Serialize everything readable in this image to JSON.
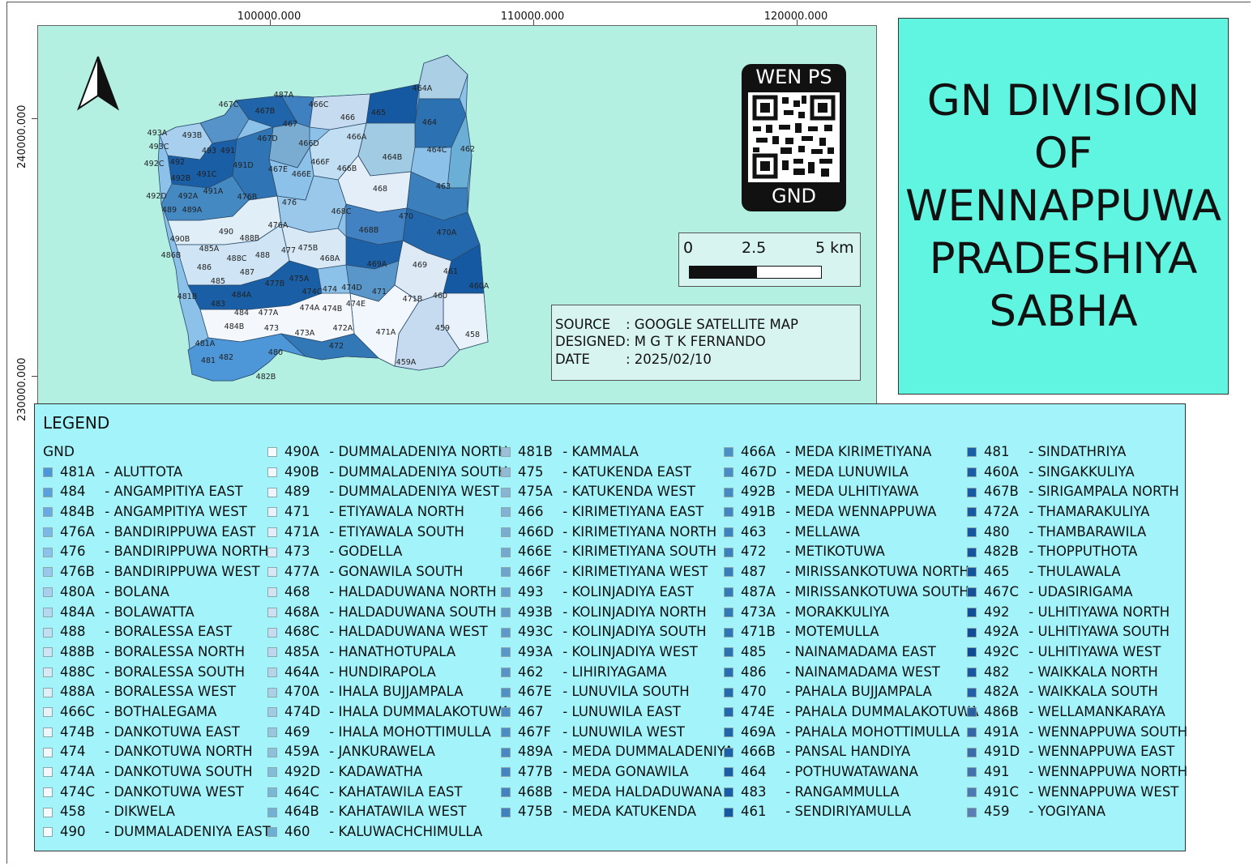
{
  "title": {
    "lines": [
      "GN  DIVISION",
      "OF",
      "WENNAPPUWA",
      "PRADESHIYA",
      "SABHA"
    ]
  },
  "map": {
    "x_coords": [
      "100000.000",
      "110000.000",
      "120000.000"
    ],
    "y_coords": [
      "240000.000",
      "230000.000"
    ],
    "background_color": "#b3f0e2",
    "north_arrow": "north-arrow-icon",
    "labels": [
      "464A",
      "466C",
      "487A",
      "467C",
      "467B",
      "467",
      "466",
      "465",
      "464",
      "493A",
      "493B",
      "493C",
      "493",
      "491",
      "467D",
      "466D",
      "466A",
      "464C",
      "462",
      "492C",
      "492",
      "491D",
      "467E",
      "466F",
      "466E",
      "466B",
      "464B",
      "492B",
      "491C",
      "491A",
      "476B",
      "468",
      "463",
      "492D",
      "492A",
      "476",
      "468C",
      "470",
      "489",
      "489A",
      "476A",
      "468B",
      "470A",
      "490",
      "488B",
      "490B",
      "485A",
      "477",
      "475B",
      "486B",
      "488C",
      "488",
      "468A",
      "469A",
      "469",
      "461",
      "486",
      "487",
      "460A",
      "485",
      "477B",
      "475A",
      "474C",
      "474",
      "474D",
      "471",
      "481B",
      "484A",
      "474A",
      "474B",
      "474E",
      "471B",
      "460",
      "483",
      "484",
      "477A",
      "484B",
      "473",
      "472A",
      "471A",
      "459",
      "458",
      "473A",
      "481A",
      "472",
      "480",
      "481",
      "482",
      "459A",
      "482B"
    ]
  },
  "qr_tag": {
    "top_text": "WEN PS",
    "bottom_text": "GND",
    "icon": "qr-code-icon"
  },
  "scale_bar": {
    "labels": [
      "0",
      "2.5",
      "5 km"
    ]
  },
  "info": {
    "source_label": "SOURCE",
    "source_value": ": GOOGLE SATELLITE MAP",
    "designed_label": "DESIGNED",
    "designed_value": ": M G T K FERNANDO",
    "date_label": "DATE",
    "date_value": ": 2025/02/10"
  },
  "legend": {
    "title": "LEGEND",
    "group": "GND",
    "columns": [
      [
        {
          "code": "481A",
          "name": "ALUTTOTA",
          "color": "#4d96d8"
        },
        {
          "code": "484",
          "name": "ANGAMPITIYA EAST",
          "color": "#5aa0dd"
        },
        {
          "code": "484B",
          "name": "ANGAMPITIYA WEST",
          "color": "#6aaae0"
        },
        {
          "code": "476A",
          "name": "BANDIRIPPUWA EAST",
          "color": "#7db7e6"
        },
        {
          "code": "476",
          "name": "BANDIRIPPUWA NORTH",
          "color": "#8cc1e9"
        },
        {
          "code": "476B",
          "name": "BANDIRIPPUWA WEST",
          "color": "#99c8eb"
        },
        {
          "code": "480A",
          "name": "BOLANA",
          "color": "#a8d0ee"
        },
        {
          "code": "484A",
          "name": "BOLAWATTA",
          "color": "#b5d8f0"
        },
        {
          "code": "488",
          "name": "BORALESSA EAST",
          "color": "#c2def2"
        },
        {
          "code": "488B",
          "name": "BORALESSA NORTH",
          "color": "#cfe4f4"
        },
        {
          "code": "488C",
          "name": "BORALESSA SOUTH",
          "color": "#d8e9f5"
        },
        {
          "code": "488A",
          "name": "BORALESSA WEST",
          "color": "#e0eef7"
        },
        {
          "code": "466C",
          "name": "BOTHALEGAMA",
          "color": "#e9f2f9"
        },
        {
          "code": "474B",
          "name": "DANKOTUWA EAST",
          "color": "#eef5fb"
        },
        {
          "code": "474",
          "name": "DANKOTUWA NORTH",
          "color": "#f2f7fc"
        },
        {
          "code": "474A",
          "name": "DANKOTUWA SOUTH",
          "color": "#f4f8fc"
        },
        {
          "code": "474C",
          "name": "DANKOTUWA WEST",
          "color": "#f5f9fd"
        },
        {
          "code": "458",
          "name": "DIKWELA",
          "color": "#f7fafd"
        },
        {
          "code": "490",
          "name": "DUMMALADENIYA EAST",
          "color": "#f7fbfd"
        }
      ],
      [
        {
          "code": "490A",
          "name": "DUMMALADENIYA NORTH",
          "color": "#f7fbff"
        },
        {
          "code": "490B",
          "name": "DUMMALADENIYA SOUTH",
          "color": "#f2f7fd"
        },
        {
          "code": "489",
          "name": "DUMMALADENIYA WEST",
          "color": "#eef5fc"
        },
        {
          "code": "471",
          "name": "ETIYAWALA NORTH",
          "color": "#e9f2fb"
        },
        {
          "code": "471A",
          "name": "ETIYAWALA SOUTH",
          "color": "#e3eef9"
        },
        {
          "code": "473",
          "name": "GODELLA",
          "color": "#deebf7"
        },
        {
          "code": "477A",
          "name": "GONAWILA SOUTH",
          "color": "#d8e7f5"
        },
        {
          "code": "468",
          "name": "HALDADUWANA NORTH",
          "color": "#d2e3f3"
        },
        {
          "code": "468A",
          "name": "HALDADUWANA SOUTH",
          "color": "#cde0f1"
        },
        {
          "code": "468C",
          "name": "HALDADUWANA WEST",
          "color": "#c6dbef"
        },
        {
          "code": "485A",
          "name": "HANATHOTUPALA",
          "color": "#bed7ec"
        },
        {
          "code": "464A",
          "name": "HUNDIRAPOLA",
          "color": "#b5d3e9"
        },
        {
          "code": "470A",
          "name": "IHALA BUJJAMPALA",
          "color": "#abcfe5"
        },
        {
          "code": "474D",
          "name": "IHALA DUMMALAKOTUWA",
          "color": "#a1cbe2"
        },
        {
          "code": "469",
          "name": "IHALA MOHOTTIMULLA",
          "color": "#98c6df"
        },
        {
          "code": "459A",
          "name": "JANKURAWELA",
          "color": "#8ec0dc"
        },
        {
          "code": "492D",
          "name": "KADAWATHA",
          "color": "#84bbd9"
        },
        {
          "code": "464C",
          "name": "KAHATAWILA EAST",
          "color": "#7ab6d6"
        },
        {
          "code": "464B",
          "name": "KAHATAWILA WEST",
          "color": "#72b1d4"
        },
        {
          "code": "460",
          "name": "KALUWACHCHIMULLA",
          "color": "#6baed6"
        }
      ],
      [
        {
          "code": "481B",
          "name": "KAMMALA",
          "color": "#9bbfd8"
        },
        {
          "code": "475",
          "name": "KATUKENDA EAST",
          "color": "#92bad6"
        },
        {
          "code": "475A",
          "name": "KATUKENDA WEST",
          "color": "#89b5d4"
        },
        {
          "code": "466",
          "name": "KIRIMETIYANA EAST",
          "color": "#82b1d3"
        },
        {
          "code": "466D",
          "name": "KIRIMETIYANA NORTH",
          "color": "#7aacd1"
        },
        {
          "code": "466E",
          "name": "KIRIMETIYANA SOUTH",
          "color": "#73a8cf"
        },
        {
          "code": "466F",
          "name": "KIRIMETIYANA WEST",
          "color": "#6da4ce"
        },
        {
          "code": "493",
          "name": "KOLINJADIYA EAST",
          "color": "#679fcc"
        },
        {
          "code": "493B",
          "name": "KOLINJADIYA NORTH",
          "color": "#629ccb"
        },
        {
          "code": "493C",
          "name": "KOLINJADIYA SOUTH",
          "color": "#5d99ca"
        },
        {
          "code": "493A",
          "name": "KOLINJADIYA WEST",
          "color": "#5996c9"
        },
        {
          "code": "462",
          "name": "LIHIRIYAGAMA",
          "color": "#5593c8"
        },
        {
          "code": "467E",
          "name": "LUNUVILA SOUTH",
          "color": "#5190c7"
        },
        {
          "code": "467",
          "name": "LUNUWILA EAST",
          "color": "#4d8dc6"
        },
        {
          "code": "467F",
          "name": "LUNUWILA WEST",
          "color": "#4a8ac5"
        },
        {
          "code": "489A",
          "name": "MEDA DUMMALADENIYA",
          "color": "#4787c4"
        },
        {
          "code": "477B",
          "name": "MEDA GONAWILA",
          "color": "#4484c3"
        },
        {
          "code": "468B",
          "name": "MEDA HALDADUWANA",
          "color": "#4282c2"
        },
        {
          "code": "475B",
          "name": "MEDA KATUKENDA",
          "color": "#3f80c1"
        }
      ],
      [
        {
          "code": "466A",
          "name": "MEDA KIRIMETIYANA",
          "color": "#4a8fc6"
        },
        {
          "code": "467D",
          "name": "MEDA LUNUWILA",
          "color": "#478cc4"
        },
        {
          "code": "492B",
          "name": "MEDA ULHITIYAWA",
          "color": "#4489c2"
        },
        {
          "code": "491B",
          "name": "MEDA WENNAPPUWA",
          "color": "#4186c0"
        },
        {
          "code": "463",
          "name": "MELLAWA",
          "color": "#3e83be"
        },
        {
          "code": "472",
          "name": "METIKOTUWA",
          "color": "#3b80bc"
        },
        {
          "code": "487",
          "name": "MIRISSANKOTUWA NORTH",
          "color": "#387dba"
        },
        {
          "code": "487A",
          "name": "MIRISSANKOTUWA SOUTH",
          "color": "#357ab8"
        },
        {
          "code": "473A",
          "name": "MORAKKULIYA",
          "color": "#3277b6"
        },
        {
          "code": "471B",
          "name": "MOTEMULLA",
          "color": "#2f74b4"
        },
        {
          "code": "485",
          "name": "NAINAMADAMA EAST",
          "color": "#2c71b2"
        },
        {
          "code": "486",
          "name": "NAINAMADAMA WEST",
          "color": "#296eb0"
        },
        {
          "code": "470",
          "name": "PAHALA BUJJAMPALA",
          "color": "#266bae"
        },
        {
          "code": "474E",
          "name": "PAHALA DUMMALAKOTUWA",
          "color": "#2368ac"
        },
        {
          "code": "469A",
          "name": "PAHALA MOHOTTIMULLA",
          "color": "#2065aa"
        },
        {
          "code": "466B",
          "name": "PANSAL HANDIYA",
          "color": "#1d62a8"
        },
        {
          "code": "464",
          "name": "POTHUWATAWANA",
          "color": "#1a5fa6"
        },
        {
          "code": "483",
          "name": "RANGAMMULLA",
          "color": "#175ca4"
        },
        {
          "code": "461",
          "name": "SENDIRIYAMULLA",
          "color": "#1459a2"
        }
      ],
      [
        {
          "code": "481",
          "name": "SINDATHRIYA",
          "color": "#1a5ea6"
        },
        {
          "code": "460A",
          "name": "SINGAKKULIYA",
          "color": "#195ca4"
        },
        {
          "code": "467B",
          "name": "SIRIGAMPALA NORTH",
          "color": "#185aa2"
        },
        {
          "code": "472A",
          "name": "THAMARAKULIYA",
          "color": "#1758a0"
        },
        {
          "code": "480",
          "name": "THAMBARAWILA",
          "color": "#16569e"
        },
        {
          "code": "482B",
          "name": "THOPPUTHOTA",
          "color": "#15549c"
        },
        {
          "code": "465",
          "name": "THULAWALA",
          "color": "#14529a"
        },
        {
          "code": "467C",
          "name": "UDASIRIGAMA",
          "color": "#135098"
        },
        {
          "code": "492",
          "name": "ULHITIYAWA NORTH",
          "color": "#124e96"
        },
        {
          "code": "492A",
          "name": "ULHITIYAWA SOUTH",
          "color": "#114c94"
        },
        {
          "code": "492C",
          "name": "ULHITIYAWA WEST",
          "color": "#104a92"
        },
        {
          "code": "482",
          "name": "WAIKKALA NORTH",
          "color": "#1a56a0"
        },
        {
          "code": "482A",
          "name": "WAIKKALA SOUTH",
          "color": "#2460a8"
        },
        {
          "code": "486B",
          "name": "WELLAMANKARAYA",
          "color": "#2a5fa0"
        },
        {
          "code": "491A",
          "name": "WENNAPPUWA SOUTH",
          "color": "#3266a4"
        },
        {
          "code": "491D",
          "name": "WENNAPPUWA EAST",
          "color": "#3a6ca8"
        },
        {
          "code": "491",
          "name": "WENNAPPUWA NORTH",
          "color": "#4272ac"
        },
        {
          "code": "491C",
          "name": "WENNAPPUWA WEST",
          "color": "#4a78b0"
        },
        {
          "code": "459",
          "name": "YOGIYANA",
          "color": "#5a7db4"
        }
      ]
    ]
  }
}
